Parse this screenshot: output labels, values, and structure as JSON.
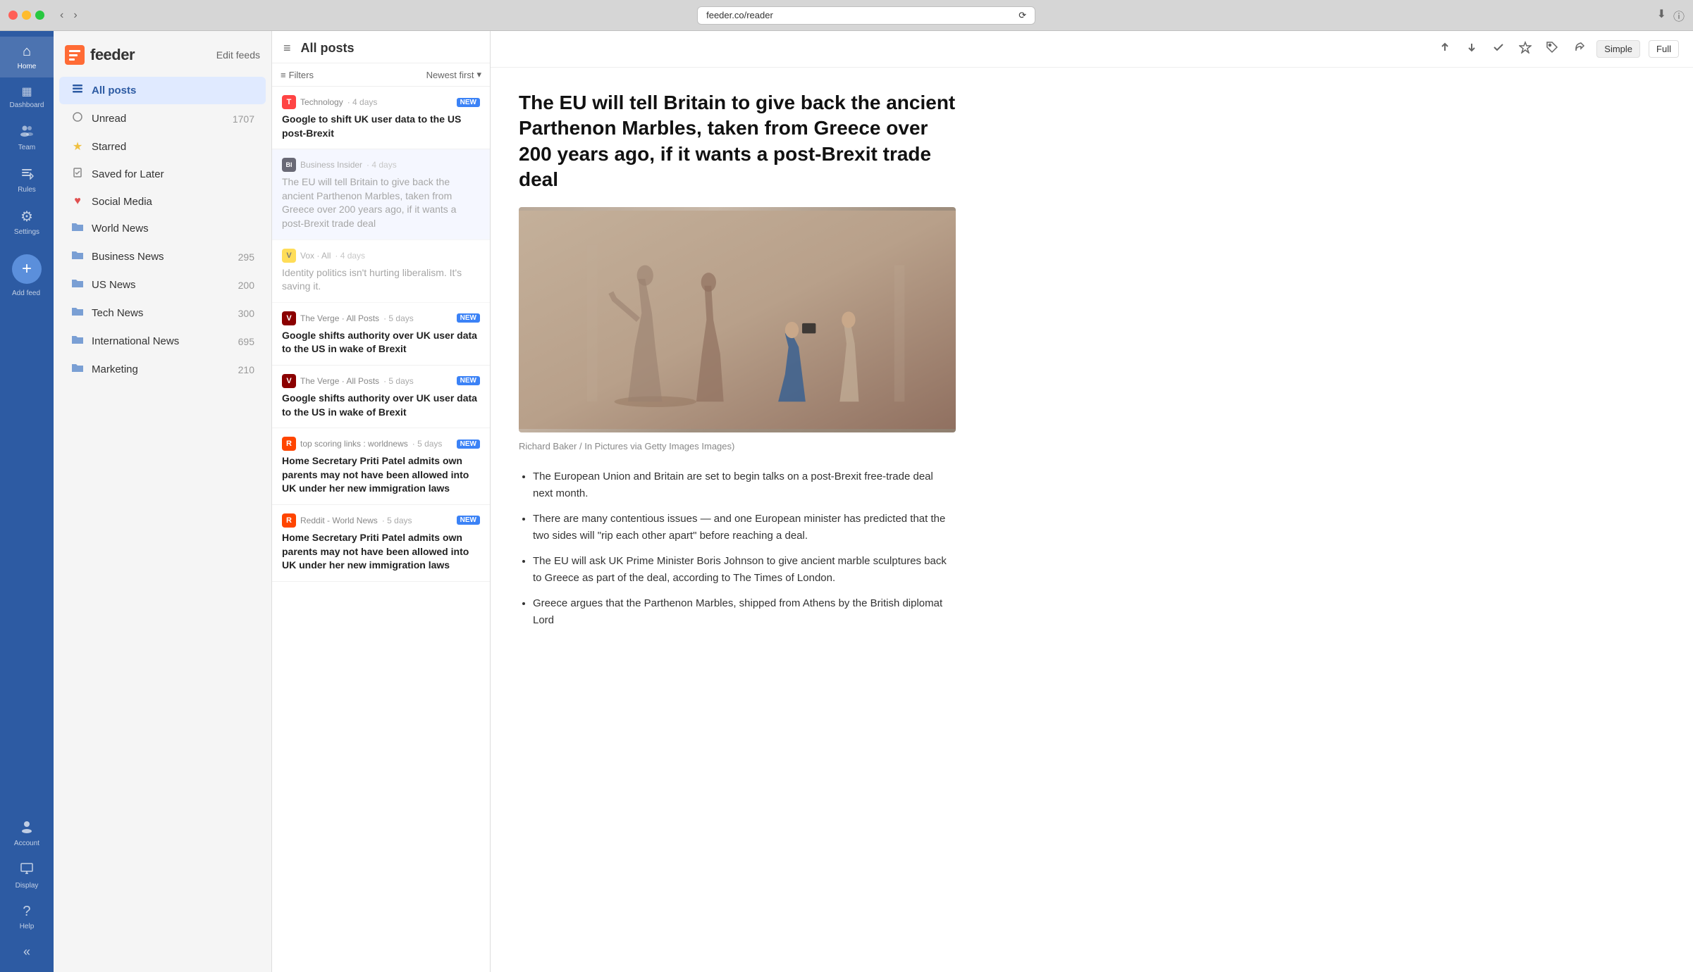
{
  "browser": {
    "url": "feeder.co/reader",
    "reload_label": "⟳"
  },
  "app": {
    "logo": "feeder",
    "edit_feeds_label": "Edit feeds"
  },
  "icon_sidebar": {
    "items": [
      {
        "id": "home",
        "icon": "⌂",
        "label": "Home",
        "active": true
      },
      {
        "id": "dashboard",
        "icon": "▦",
        "label": "Dashboard",
        "active": false
      },
      {
        "id": "team",
        "icon": "👥",
        "label": "Team",
        "active": false
      },
      {
        "id": "rules",
        "icon": "⧖",
        "label": "Rules",
        "active": false
      },
      {
        "id": "settings",
        "icon": "⚙",
        "label": "Settings",
        "active": false
      },
      {
        "id": "account",
        "icon": "○",
        "label": "Account",
        "active": false
      }
    ],
    "add_feed_label": "Add feed",
    "display_label": "Display",
    "help_label": "Help",
    "collapse_label": "«"
  },
  "feeds_sidebar": {
    "special_items": [
      {
        "id": "all-posts",
        "icon": "≡",
        "icon_type": "lines",
        "name": "All posts",
        "count": "",
        "active": true
      },
      {
        "id": "unread",
        "icon": "○",
        "icon_type": "circle",
        "name": "Unread",
        "count": "1707",
        "active": false
      },
      {
        "id": "starred",
        "icon": "★",
        "icon_type": "star",
        "name": "Starred",
        "count": "",
        "active": false
      }
    ],
    "other_items": [
      {
        "id": "saved-later",
        "icon": "☐",
        "icon_type": "bookmark",
        "name": "Saved for Later",
        "count": ""
      },
      {
        "id": "social-media",
        "icon": "♥",
        "icon_type": "heart",
        "name": "Social Media",
        "count": ""
      }
    ],
    "feed_items": [
      {
        "id": "world-news",
        "icon": "📁",
        "icon_type": "folder",
        "name": "World News",
        "count": ""
      },
      {
        "id": "business-news",
        "icon": "📁",
        "icon_type": "folder",
        "name": "Business News",
        "count": "295"
      },
      {
        "id": "us-news",
        "icon": "📁",
        "icon_type": "folder",
        "name": "US News",
        "count": "200"
      },
      {
        "id": "tech-news",
        "icon": "📁",
        "icon_type": "folder",
        "name": "Tech News",
        "count": "300"
      },
      {
        "id": "international-news",
        "icon": "📁",
        "icon_type": "folder",
        "name": "International News",
        "count": "695"
      },
      {
        "id": "marketing",
        "icon": "📁",
        "icon_type": "folder",
        "name": "Marketing",
        "count": "210"
      }
    ]
  },
  "posts_panel": {
    "title": "All posts",
    "filters_label": "Filters",
    "sort_label": "Newest first",
    "posts": [
      {
        "id": 1,
        "source": "Technology",
        "source_icon": "T",
        "source_color": "#ff4444",
        "age": "4 days",
        "is_new": true,
        "is_read": false,
        "title": "Google to shift UK user data to the US post-Brexit",
        "active": false
      },
      {
        "id": 2,
        "source": "Business Insider",
        "source_abbr": "BI",
        "source_icon": "BI",
        "source_color": "#1a1a2e",
        "age": "4 days",
        "is_new": false,
        "is_read": true,
        "title": "The EU will tell Britain to give back the ancient Parthenon Marbles, taken from Greece over 200 years ago, if it wants a post-Brexit trade deal",
        "active": true
      },
      {
        "id": 3,
        "source": "Vox",
        "source_sub": "All",
        "source_icon": "V",
        "source_color": "#ffcc00",
        "age": "4 days",
        "is_new": false,
        "is_read": true,
        "title": "Identity politics isn't hurting liberalism. It's saving it.",
        "active": false
      },
      {
        "id": 4,
        "source": "The Verge",
        "source_sub": "All Posts",
        "source_icon": "V",
        "source_color": "#8b0000",
        "age": "5 days",
        "is_new": true,
        "is_read": false,
        "title": "Google shifts authority over UK user data to the US in wake of Brexit",
        "active": false
      },
      {
        "id": 5,
        "source": "The Verge",
        "source_sub": "All Posts",
        "source_icon": "V",
        "source_color": "#8b0000",
        "age": "5 days",
        "is_new": true,
        "is_read": false,
        "title": "Google shifts authority over UK user data to the US in wake of Brexit",
        "active": false
      },
      {
        "id": 6,
        "source": "top scoring links : worldnews",
        "source_icon": "R",
        "source_color": "#ff4500",
        "age": "5 days",
        "is_new": true,
        "is_read": false,
        "title": "Home Secretary Priti Patel admits own parents may not have been allowed into UK under her new immigration laws",
        "active": false
      },
      {
        "id": 7,
        "source": "Reddit - World News",
        "source_icon": "R",
        "source_color": "#ff4500",
        "age": "5 days",
        "is_new": true,
        "is_read": false,
        "title": "Home Secretary Priti Patel admits own parents may not have been allowed into UK under her new immigration laws",
        "active": false
      }
    ]
  },
  "content": {
    "title": "The EU will tell Britain to give back the ancient Parthenon Marbles, taken from Greece over 200 years ago, if it wants a post-Brexit trade deal",
    "image_caption": "Richard Baker / In Pictures via Getty Images Images)",
    "bullets": [
      "The European Union and Britain are set to begin talks on a post-Brexit free-trade deal next month.",
      "There are many contentious issues — and one European minister has predicted that the two sides will \"rip each other apart\" before reaching a deal.",
      "The EU will ask UK Prime Minister Boris Johnson to give ancient marble sculptures back to Greece as part of the deal, according to The Times of London.",
      "Greece argues that the Parthenon Marbles, shipped from Athens by the British diplomat Lord"
    ],
    "toolbar": {
      "up_icon": "↑",
      "down_icon": "↓",
      "check_icon": "✓",
      "star_icon": "★",
      "tag_icon": "⬨",
      "share_icon": "↗",
      "simple_label": "Simple",
      "full_label": "Full"
    }
  }
}
